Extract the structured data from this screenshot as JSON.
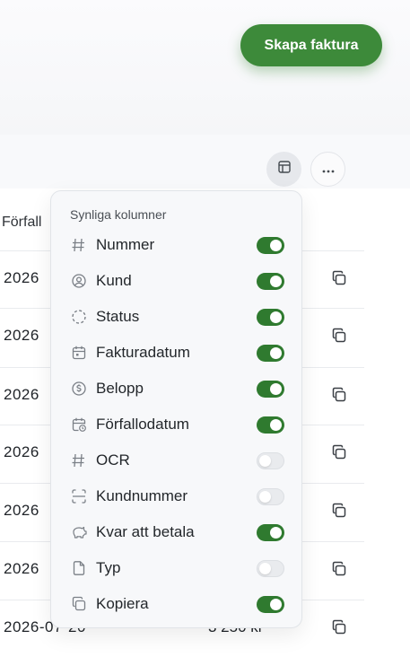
{
  "header": {
    "create_invoice_label": "Skapa faktura"
  },
  "toolbar": {
    "columns_icon": "table-icon",
    "more_icon": "more-horizontal-icon"
  },
  "table": {
    "due_date_header": "Förfall",
    "rows": [
      {
        "date": "2026",
        "amount": ""
      },
      {
        "date": "2026",
        "amount": ""
      },
      {
        "date": "2026",
        "amount": ""
      },
      {
        "date": "2026",
        "amount": ""
      },
      {
        "date": "2026",
        "amount": ""
      },
      {
        "date": "2026",
        "amount": ""
      },
      {
        "date": "2026-07-20",
        "amount": "3 250 kr"
      }
    ]
  },
  "column_menu": {
    "title": "Synliga kolumner",
    "options": [
      {
        "label": "Nummer",
        "icon": "hash-icon",
        "enabled": true
      },
      {
        "label": "Kund",
        "icon": "user-circle-icon",
        "enabled": true
      },
      {
        "label": "Status",
        "icon": "dashed-circle-icon",
        "enabled": true
      },
      {
        "label": "Fakturadatum",
        "icon": "calendar-icon",
        "enabled": true
      },
      {
        "label": "Belopp",
        "icon": "dollar-circle-icon",
        "enabled": true
      },
      {
        "label": "Förfallodatum",
        "icon": "calendar-clock-icon",
        "enabled": true
      },
      {
        "label": "OCR",
        "icon": "hash-icon",
        "enabled": false
      },
      {
        "label": "Kundnummer",
        "icon": "scan-icon",
        "enabled": false
      },
      {
        "label": "Kvar att betala",
        "icon": "piggy-bank-icon",
        "enabled": true
      },
      {
        "label": "Typ",
        "icon": "file-icon",
        "enabled": false
      },
      {
        "label": "Kopiera",
        "icon": "copy-icon",
        "enabled": true
      }
    ]
  },
  "colors": {
    "accent": "#3d8a3a",
    "toggle_on": "#2f7a2f",
    "toggle_off": "#e9ebee"
  }
}
